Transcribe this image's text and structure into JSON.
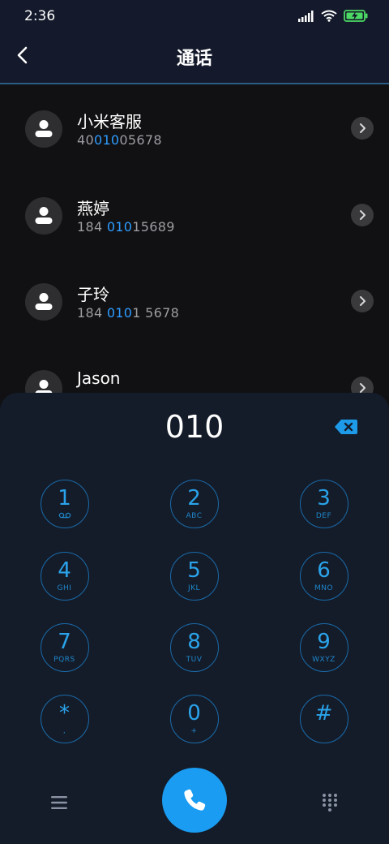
{
  "status": {
    "time": "2:36"
  },
  "header": {
    "title": "通话"
  },
  "contacts": [
    {
      "name": "小米客服",
      "number_pre": "40",
      "number_match": "010",
      "number_post": "05678"
    },
    {
      "name": "燕婷",
      "number_pre": "184 ",
      "number_match": "010",
      "number_post": "15689"
    },
    {
      "name": "子玲",
      "number_pre": "184 ",
      "number_match": "010",
      "number_post": "1 5678"
    },
    {
      "name": "Jason",
      "number_pre": "",
      "number_match": "",
      "number_post": ""
    }
  ],
  "dialer": {
    "display": "010",
    "keys": [
      {
        "digit": "1",
        "letters": ""
      },
      {
        "digit": "2",
        "letters": "ABC"
      },
      {
        "digit": "3",
        "letters": "DEF"
      },
      {
        "digit": "4",
        "letters": "GHI"
      },
      {
        "digit": "5",
        "letters": "JKL"
      },
      {
        "digit": "6",
        "letters": "MNO"
      },
      {
        "digit": "7",
        "letters": "PQRS"
      },
      {
        "digit": "8",
        "letters": "TUV"
      },
      {
        "digit": "9",
        "letters": "WXYZ"
      },
      {
        "digit": "*",
        "letters": ","
      },
      {
        "digit": "0",
        "letters": "+"
      },
      {
        "digit": "#",
        "letters": ""
      }
    ]
  },
  "colors": {
    "accent": "#1a9cf2",
    "highlight": "#2e9bff",
    "key_border": "#1a6aa8",
    "battery": "#4cd964"
  },
  "icons": {
    "back": "back-arrow-icon",
    "chevron": "chevron-right-icon",
    "backspace": "backspace-icon",
    "voicemail": "voicemail-icon",
    "menu": "menu-icon",
    "call": "phone-icon",
    "keypad": "keypad-icon"
  }
}
